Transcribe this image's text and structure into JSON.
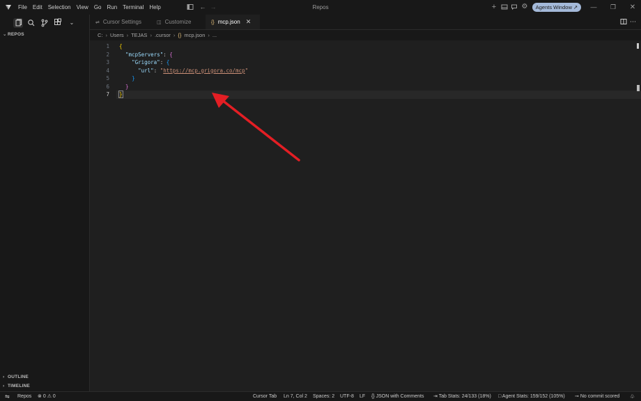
{
  "titlebar": {
    "title": "Repos",
    "menu": [
      "File",
      "Edit",
      "Selection",
      "View",
      "Go",
      "Run",
      "Terminal",
      "Help"
    ],
    "agents_button": "Agents Window ↗"
  },
  "sidebar": {
    "section_repos": "REPOS",
    "section_outline": "OUTLINE",
    "section_timeline": "TIMELINE"
  },
  "tabs": [
    {
      "label": "Cursor Settings",
      "icon": "settings-icon"
    },
    {
      "label": "Customize",
      "icon": "customize-icon"
    },
    {
      "label": "mcp.json",
      "icon": "json-braces-icon",
      "active": true
    }
  ],
  "breadcrumb": [
    "C:",
    "Users",
    "TEJAS",
    ".cursor",
    "mcp.json",
    "..."
  ],
  "editor": {
    "line_numbers": [
      "1",
      "2",
      "3",
      "4",
      "5",
      "6",
      "7"
    ],
    "current_line": 7,
    "key_mcp": "\"mcpServers\"",
    "key_grigora": "\"Grigora\"",
    "key_url": "\"url\"",
    "url_value": "https://mcp.grigora.co/mcp"
  },
  "statusbar": {
    "branch_area": "Repos",
    "errors": "0",
    "warnings": "0",
    "cursor_tab": "Cursor Tab",
    "position": "Ln 7, Col 2",
    "spaces": "Spaces: 2",
    "encoding": "UTF-8",
    "eol": "LF",
    "language": "JSON with Comments",
    "tab_stats": "Tab Stats: 24/133 (18%)",
    "agent_stats": "Agent Stats: 159/152 (105%)",
    "commit": "No commit scored"
  },
  "colors": {
    "annotation_arrow": "#e31e24",
    "agents_button": "#a4b9d9"
  }
}
